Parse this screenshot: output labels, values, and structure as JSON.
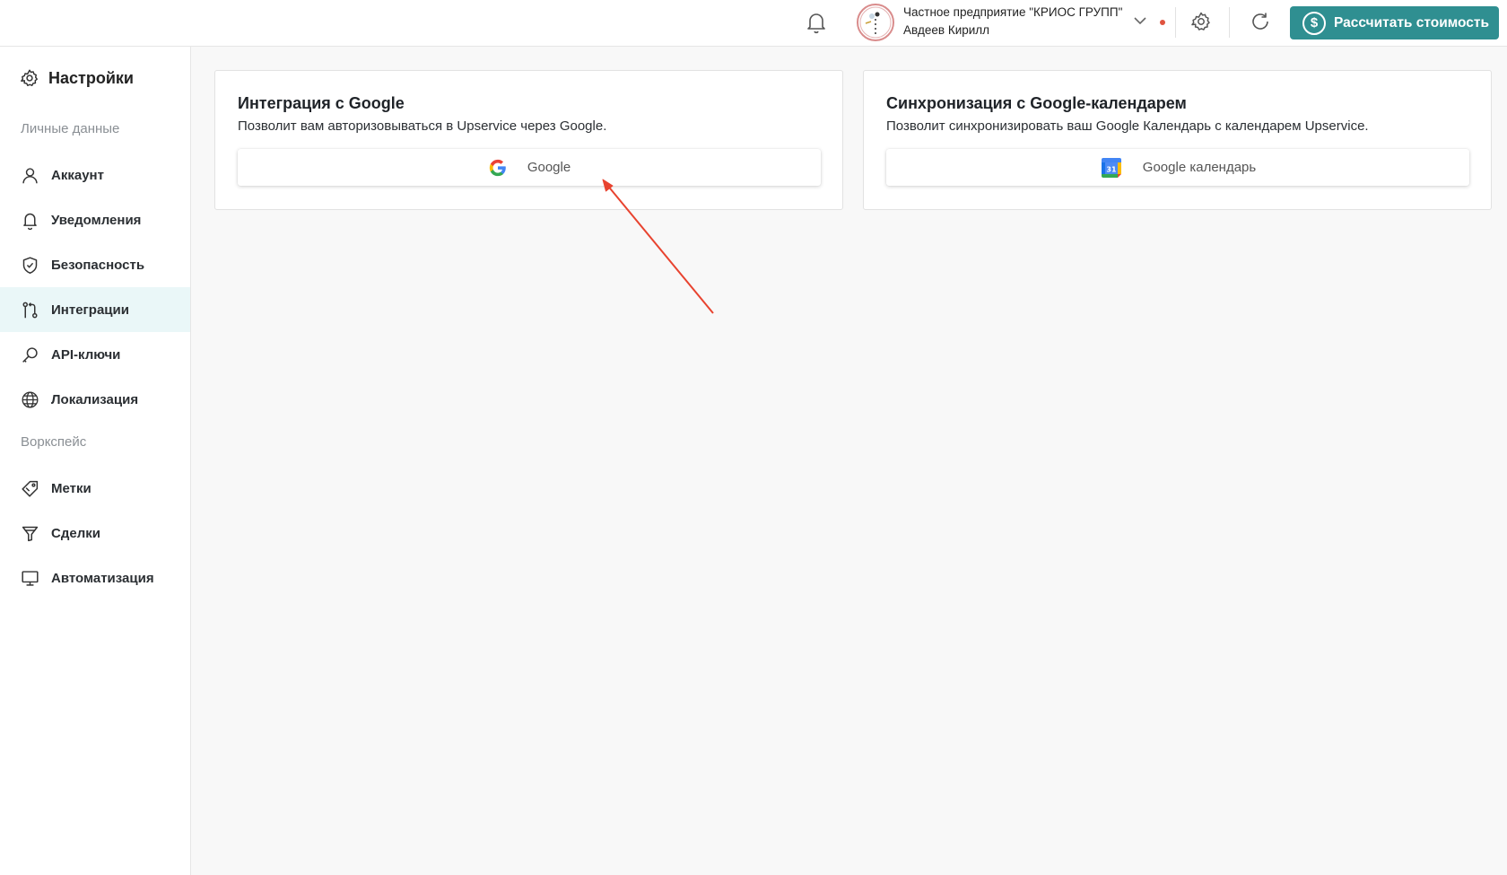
{
  "header": {
    "org_name": "Частное предприятие \"КРИОС ГРУПП\"",
    "user_name": "Авдеев Кирилл",
    "calc_button_label": "Рассчитать стоимость",
    "calc_button_icon": "$",
    "accent_color": "#2f8f91",
    "icons": [
      "bell-icon",
      "avatar",
      "chevron-down-icon",
      "status-dot",
      "gear-icon",
      "refresh-icon",
      "dollar-icon"
    ]
  },
  "sidebar": {
    "title": "Настройки",
    "section_personal": "Личные данные",
    "section_workspace": "Воркспейс",
    "items": [
      {
        "label": "Аккаунт",
        "icon": "user-icon",
        "active": false
      },
      {
        "label": "Уведомления",
        "icon": "bell-icon",
        "active": false
      },
      {
        "label": "Безопасность",
        "icon": "shield-icon",
        "active": false
      },
      {
        "label": "Интеграции",
        "icon": "git-merge-icon",
        "active": true
      },
      {
        "label": "API-ключи",
        "icon": "key-icon",
        "active": false
      },
      {
        "label": "Локализация",
        "icon": "globe-icon",
        "active": false
      },
      {
        "label": "Метки",
        "icon": "tag-icon",
        "active": false
      },
      {
        "label": "Сделки",
        "icon": "funnel-icon",
        "active": false
      },
      {
        "label": "Автоматизация",
        "icon": "monitor-icon",
        "active": false
      }
    ]
  },
  "main": {
    "google_card": {
      "title": "Интеграция с Google",
      "description": "Позволит вам авторизовываться в Upservice через Google.",
      "button_label": "Google"
    },
    "calendar_card": {
      "title": "Синхронизация с Google-календарем",
      "description": "Позволит синхронизировать ваш Google Календарь с календарем Upservice.",
      "button_label": "Google календарь",
      "calendar_icon_text": "31"
    },
    "annotation_arrow_color": "#e8432f"
  }
}
